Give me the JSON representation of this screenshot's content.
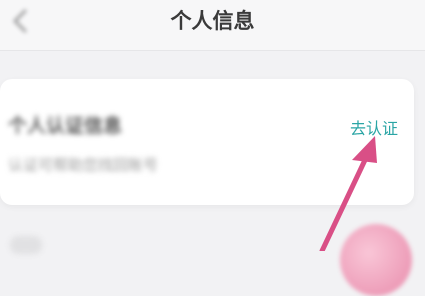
{
  "header": {
    "title": "个人信息"
  },
  "identity_card": {
    "title": "个人认证信息",
    "subtitle": "认证可帮助您找回账号",
    "verify_label": "去认证"
  },
  "colors": {
    "accent_teal": "#2aa5a5",
    "arrow_pink": "#d94f86"
  },
  "icons": {
    "back": "back-arrow-icon",
    "pointer": "annotation-arrow"
  }
}
